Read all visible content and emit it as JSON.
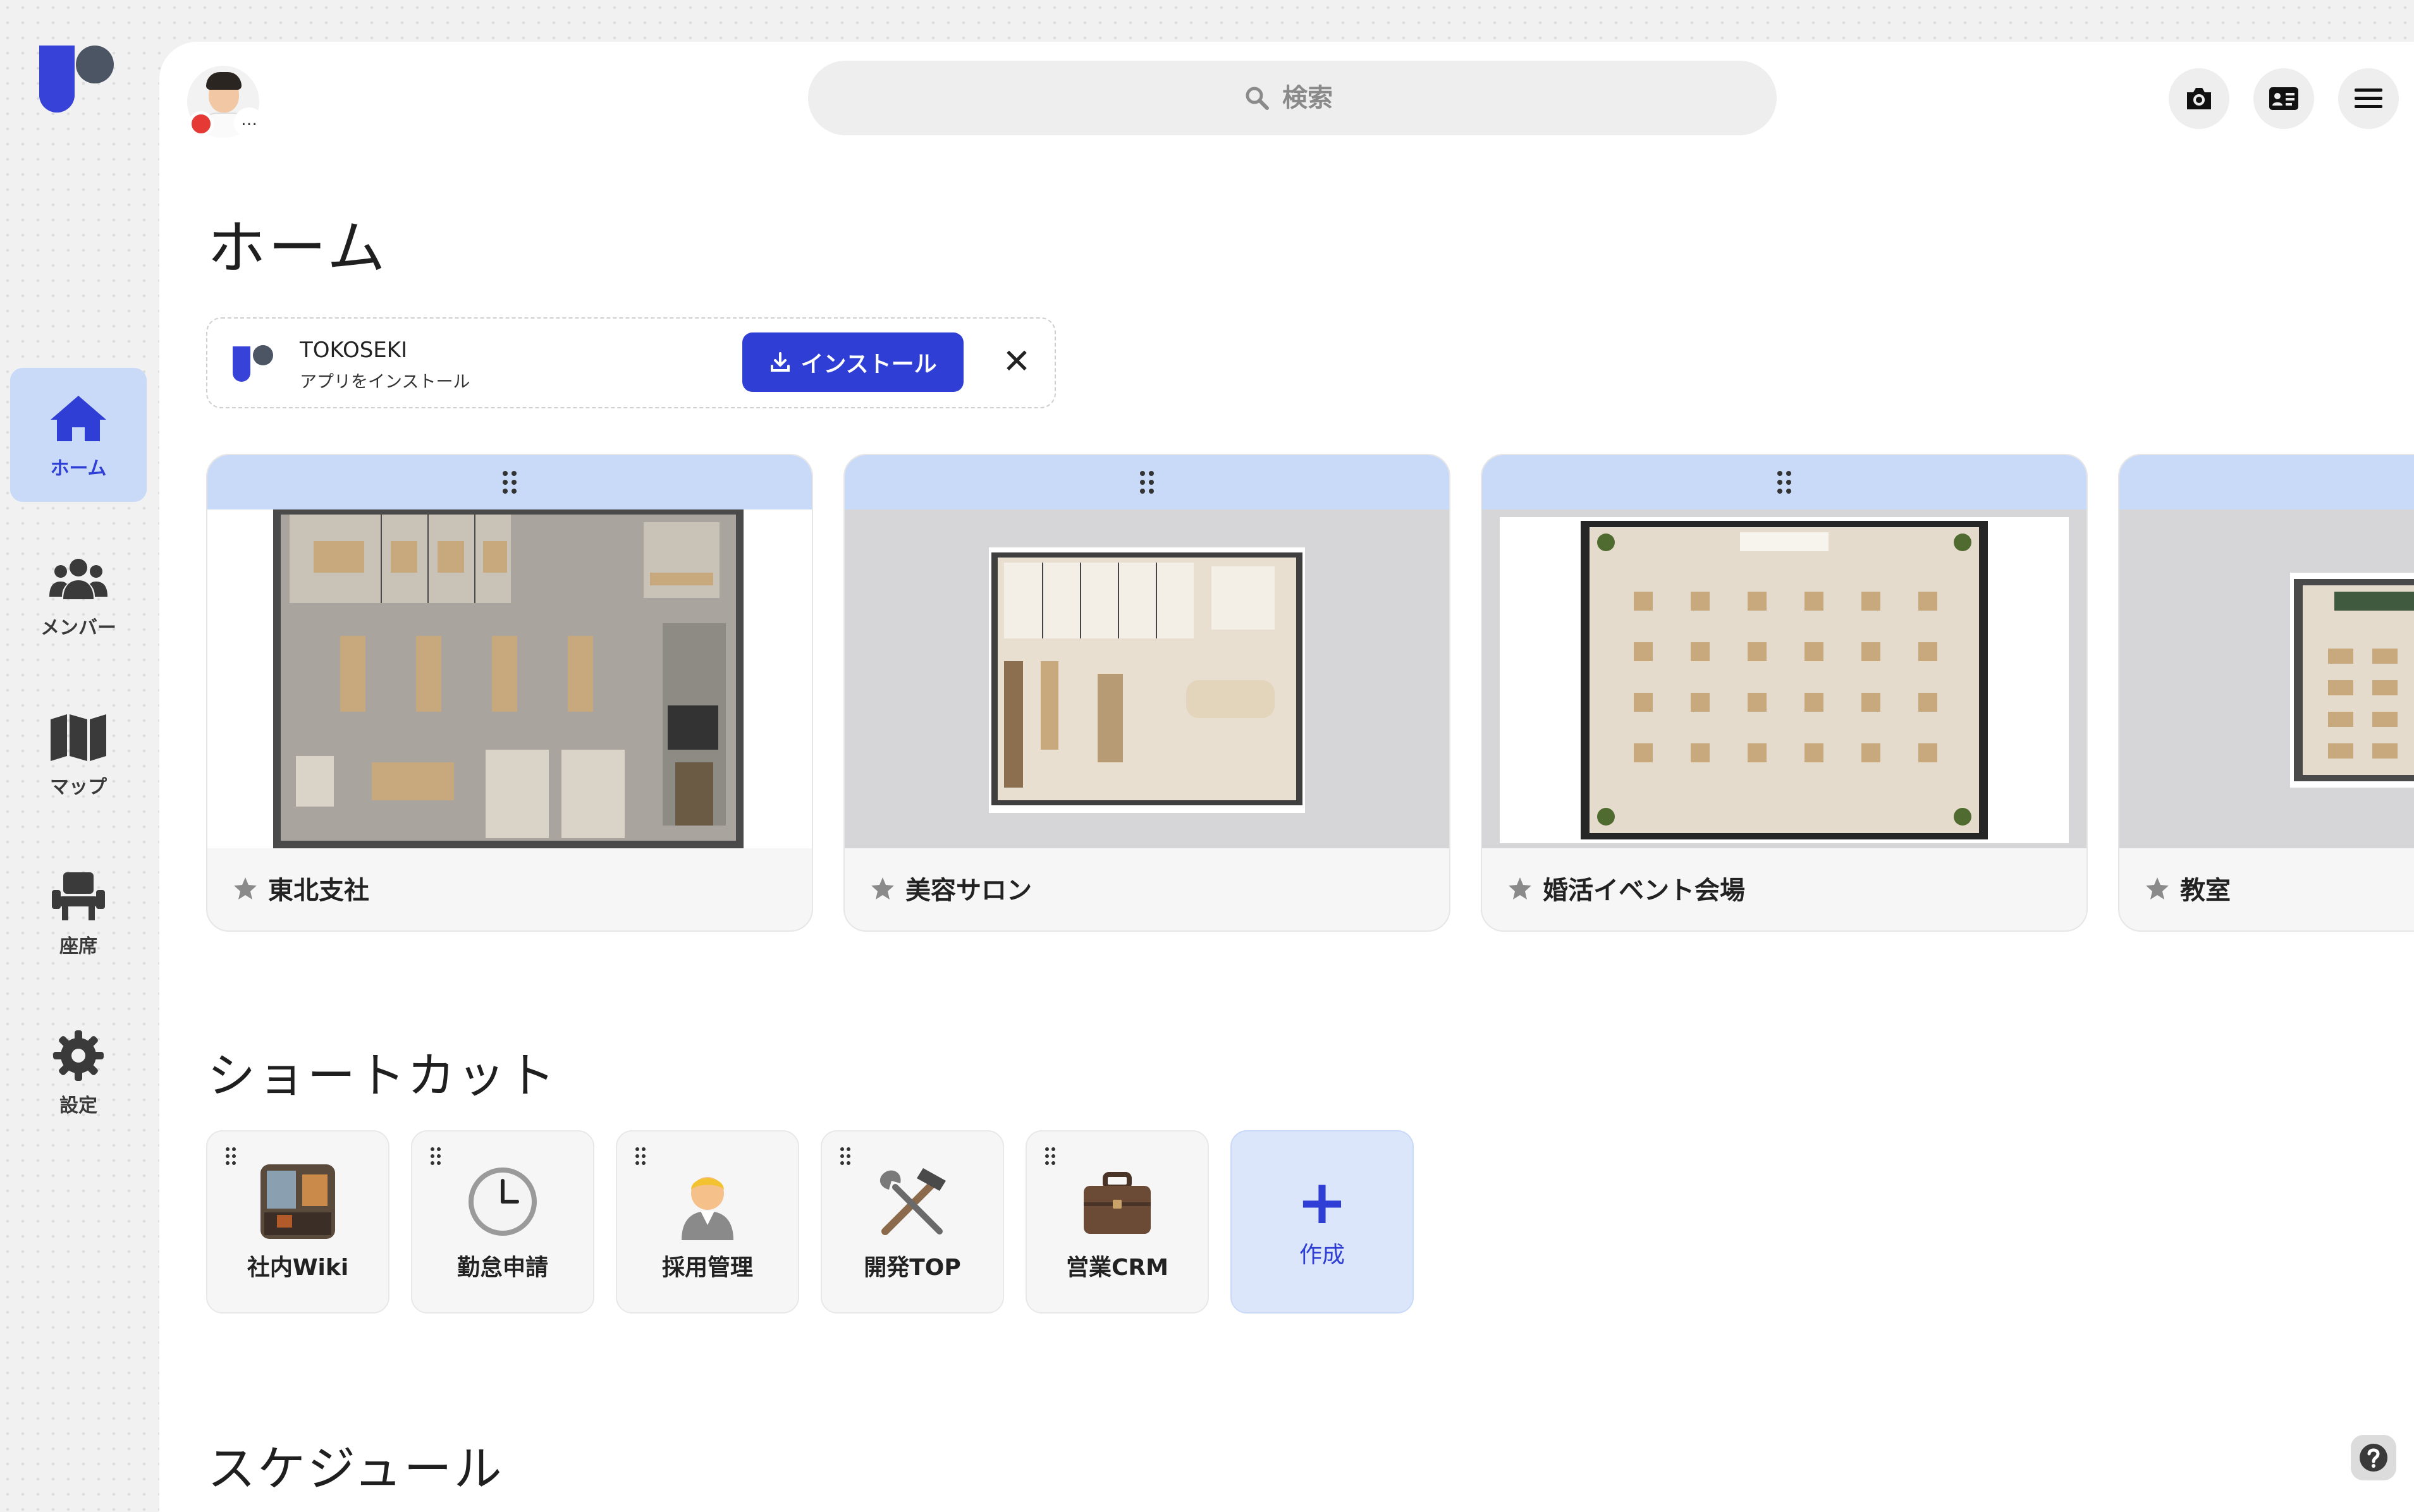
{
  "nav": {
    "items": [
      {
        "label": "ホーム",
        "icon": "home-icon",
        "active": true
      },
      {
        "label": "メンバー",
        "icon": "users-icon",
        "active": false
      },
      {
        "label": "マップ",
        "icon": "map-icon",
        "active": false
      },
      {
        "label": "座席",
        "icon": "chair-icon",
        "active": false
      },
      {
        "label": "設定",
        "icon": "gear-icon",
        "active": false
      }
    ]
  },
  "header": {
    "search_placeholder": "検索",
    "status_more": "…"
  },
  "page": {
    "title": "ホーム"
  },
  "install_banner": {
    "app_name": "TOKOSEKI",
    "subtitle": "アプリをインストール",
    "button_label": "インストール",
    "close_label": "✕"
  },
  "maps": [
    {
      "name": "東北支社"
    },
    {
      "name": "美容サロン"
    },
    {
      "name": "婚活イベント会場"
    },
    {
      "name": "教室"
    }
  ],
  "shortcuts": {
    "title": "ショートカット",
    "items": [
      {
        "label": "社内Wiki",
        "icon": "office-photo-icon"
      },
      {
        "label": "勤怠申請",
        "icon": "clock-icon"
      },
      {
        "label": "採用管理",
        "icon": "person-icon"
      },
      {
        "label": "開発TOP",
        "icon": "tools-icon"
      },
      {
        "label": "営業CRM",
        "icon": "briefcase-icon"
      }
    ],
    "create_label": "作成"
  },
  "schedule": {
    "title": "スケジュール"
  },
  "colors": {
    "accent": "#2f3ed4",
    "active_bg": "#c9d9f8",
    "status_red": "#e53935"
  }
}
